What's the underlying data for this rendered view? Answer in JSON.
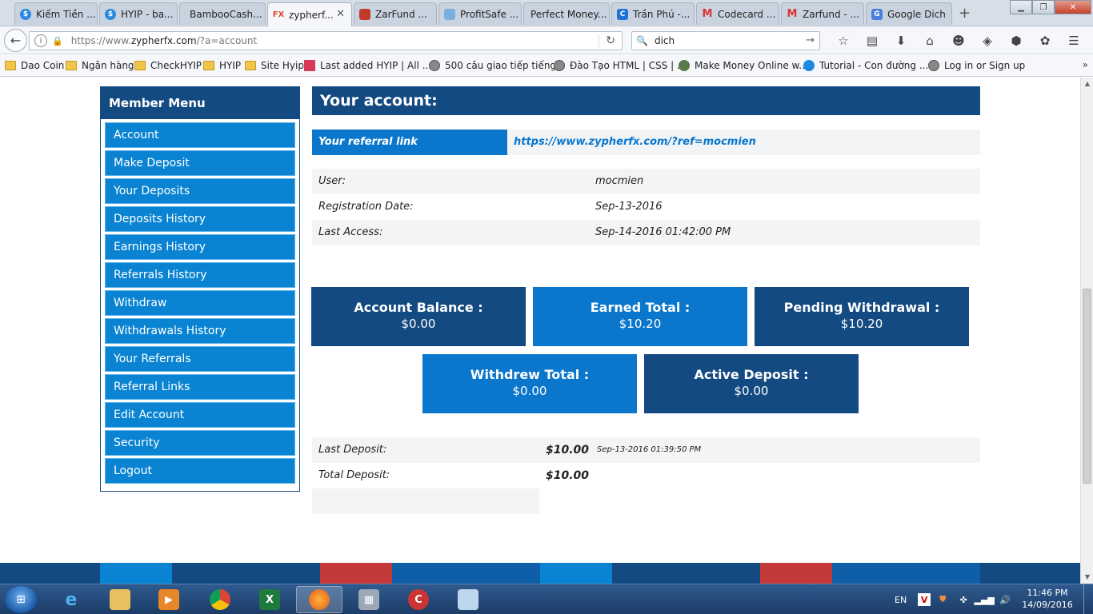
{
  "browser": {
    "tabs": [
      {
        "title": "Kiếm Tiền ...",
        "icon": "dollar-circle-icon",
        "color": "#2a8ae0"
      },
      {
        "title": "HYIP - ba...",
        "icon": "dollar-circle-icon",
        "color": "#2a8ae0"
      },
      {
        "title": "BambooCash...",
        "icon": "",
        "color": ""
      },
      {
        "title": "zypherf...",
        "icon": "fx-logo-icon",
        "color": "#e0482a",
        "active": true
      },
      {
        "title": "ZarFund ...",
        "icon": "flag-icon",
        "color": "#c0392b"
      },
      {
        "title": "ProfitSafe ...",
        "icon": "page-icon",
        "color": "#7ab0e0"
      },
      {
        "title": "Perfect Money...",
        "icon": "",
        "color": ""
      },
      {
        "title": "Trần Phú -...",
        "icon": "c-letter-icon",
        "color": "#1e73d6"
      },
      {
        "title": "Codecard ...",
        "icon": "gmail-icon",
        "color": "#d33"
      },
      {
        "title": "Zarfund - ...",
        "icon": "gmail-icon",
        "color": "#d33"
      },
      {
        "title": "Google Dich",
        "icon": "translate-icon",
        "color": "#4a7fe0"
      }
    ],
    "address": {
      "prefix": "https://www.",
      "domain": "zypherfx.com",
      "path": "/?a=account"
    },
    "search": {
      "query": "dich"
    },
    "bookmarks": [
      {
        "label": "Dao Coin",
        "type": "folder"
      },
      {
        "label": "Ngân hàng",
        "type": "folder"
      },
      {
        "label": "CheckHYIP",
        "type": "folder"
      },
      {
        "label": "HYIP",
        "type": "folder"
      },
      {
        "label": "Site Hyip",
        "type": "folder"
      },
      {
        "label": "Last added HYIP | All ...",
        "type": "red"
      },
      {
        "label": "500 câu giao tiếp tiếng...",
        "type": "globe"
      },
      {
        "label": "Đào Tạo HTML | CSS | ...",
        "type": "globe"
      },
      {
        "label": "Make Money Online w...",
        "type": "green"
      },
      {
        "label": "Tutorial - Con đường ...",
        "type": "blue"
      },
      {
        "label": "Log in or Sign up",
        "type": "globe"
      }
    ],
    "bookmarks_more": "»"
  },
  "menu": {
    "title": "Member Menu",
    "items": [
      "Account",
      "Make Deposit",
      "Your Deposits",
      "Deposits History",
      "Earnings History",
      "Referrals History",
      "Withdraw",
      "Withdrawals History",
      "Your Referrals",
      "Referral Links",
      "Edit Account",
      "Security",
      "Logout"
    ]
  },
  "account": {
    "title": "Your account:",
    "referral_label": "Your referral link",
    "referral_url": "https://www.zypherfx.com/?ref=mocmien",
    "info": [
      {
        "label": "User:",
        "value": "mocmien"
      },
      {
        "label": "Registration Date:",
        "value": "Sep-13-2016"
      },
      {
        "label": "Last Access:",
        "value": "Sep-14-2016 01:42:00 PM"
      }
    ],
    "stats": [
      {
        "label": "Account Balance :",
        "value": "$0.00",
        "tone": "dark"
      },
      {
        "label": "Earned Total :",
        "value": "$10.20",
        "tone": "light"
      },
      {
        "label": "Pending Withdrawal :",
        "value": "$10.20",
        "tone": "dark"
      },
      {
        "label": "Withdrew Total :",
        "value": "$0.00",
        "tone": "light"
      },
      {
        "label": "Active Deposit :",
        "value": "$0.00",
        "tone": "dark"
      }
    ],
    "last_deposit": {
      "label": "Last Deposit:",
      "amount": "$10.00",
      "date": "Sep-13-2016 01:39:50 PM"
    },
    "total_deposit": {
      "label": "Total Deposit:",
      "amount": "$10.00"
    }
  },
  "taskbar": {
    "lang": "EN",
    "time": "11:46 PM",
    "date": "14/09/2016"
  },
  "colors": {
    "navy": "#134a82",
    "blue": "#0a77cc",
    "menu_blue": "#0a84d2"
  }
}
